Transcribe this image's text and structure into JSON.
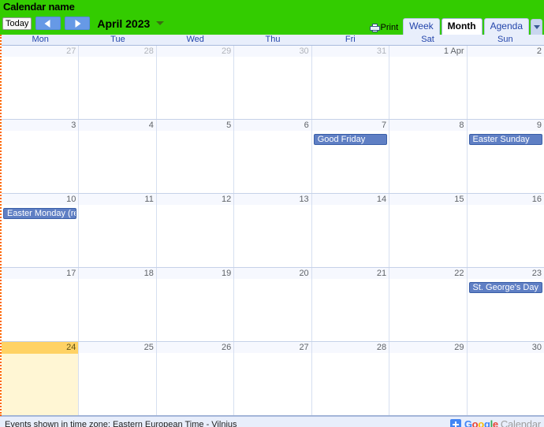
{
  "header": {
    "calendar_name": "Calendar name",
    "today_button": "Today",
    "prev_label": "Previous",
    "next_label": "Next",
    "period": "April 2023",
    "print_label": "Print",
    "views": [
      {
        "label": "Week",
        "active": false
      },
      {
        "label": "Month",
        "active": true
      },
      {
        "label": "Agenda",
        "active": false
      }
    ],
    "background_color": "#33cc00",
    "title_color": "#000000"
  },
  "weekdays": [
    "Mon",
    "Tue",
    "Wed",
    "Thu",
    "Fri",
    "Sat",
    "Sun"
  ],
  "weeks": [
    {
      "days": [
        {
          "num": "27",
          "othermonth": true,
          "today": false,
          "events": []
        },
        {
          "num": "28",
          "othermonth": true,
          "today": false,
          "events": []
        },
        {
          "num": "29",
          "othermonth": true,
          "today": false,
          "events": []
        },
        {
          "num": "30",
          "othermonth": true,
          "today": false,
          "events": []
        },
        {
          "num": "31",
          "othermonth": true,
          "today": false,
          "events": []
        },
        {
          "num": "1 Apr",
          "othermonth": false,
          "today": false,
          "events": []
        },
        {
          "num": "2",
          "othermonth": false,
          "today": false,
          "events": []
        }
      ]
    },
    {
      "days": [
        {
          "num": "3",
          "othermonth": false,
          "today": false,
          "events": []
        },
        {
          "num": "4",
          "othermonth": false,
          "today": false,
          "events": []
        },
        {
          "num": "5",
          "othermonth": false,
          "today": false,
          "events": []
        },
        {
          "num": "6",
          "othermonth": false,
          "today": false,
          "events": []
        },
        {
          "num": "7",
          "othermonth": false,
          "today": false,
          "events": [
            "Good Friday"
          ]
        },
        {
          "num": "8",
          "othermonth": false,
          "today": false,
          "events": []
        },
        {
          "num": "9",
          "othermonth": false,
          "today": false,
          "events": [
            "Easter Sunday"
          ]
        }
      ]
    },
    {
      "days": [
        {
          "num": "10",
          "othermonth": false,
          "today": false,
          "events": [
            "Easter Monday (re"
          ]
        },
        {
          "num": "11",
          "othermonth": false,
          "today": false,
          "events": []
        },
        {
          "num": "12",
          "othermonth": false,
          "today": false,
          "events": []
        },
        {
          "num": "13",
          "othermonth": false,
          "today": false,
          "events": []
        },
        {
          "num": "14",
          "othermonth": false,
          "today": false,
          "events": []
        },
        {
          "num": "15",
          "othermonth": false,
          "today": false,
          "events": []
        },
        {
          "num": "16",
          "othermonth": false,
          "today": false,
          "events": []
        }
      ]
    },
    {
      "days": [
        {
          "num": "17",
          "othermonth": false,
          "today": false,
          "events": []
        },
        {
          "num": "18",
          "othermonth": false,
          "today": false,
          "events": []
        },
        {
          "num": "19",
          "othermonth": false,
          "today": false,
          "events": []
        },
        {
          "num": "20",
          "othermonth": false,
          "today": false,
          "events": []
        },
        {
          "num": "21",
          "othermonth": false,
          "today": false,
          "events": []
        },
        {
          "num": "22",
          "othermonth": false,
          "today": false,
          "events": []
        },
        {
          "num": "23",
          "othermonth": false,
          "today": false,
          "events": [
            "St. George's Day"
          ]
        }
      ]
    },
    {
      "days": [
        {
          "num": "24",
          "othermonth": false,
          "today": true,
          "events": []
        },
        {
          "num": "25",
          "othermonth": false,
          "today": false,
          "events": []
        },
        {
          "num": "26",
          "othermonth": false,
          "today": false,
          "events": []
        },
        {
          "num": "27",
          "othermonth": false,
          "today": false,
          "events": []
        },
        {
          "num": "28",
          "othermonth": false,
          "today": false,
          "events": []
        },
        {
          "num": "29",
          "othermonth": false,
          "today": false,
          "events": []
        },
        {
          "num": "30",
          "othermonth": false,
          "today": false,
          "events": []
        }
      ]
    }
  ],
  "footer": {
    "timezone_note": "Events shown in time zone: Eastern European Time - Vilnius",
    "brand_google": "Google",
    "brand_product": "Calendar",
    "brand_letters": [
      "G",
      "o",
      "o",
      "g",
      "l",
      "e"
    ]
  },
  "colors": {
    "event_fill": "#5f7fc4",
    "event_border": "#3a5fa8",
    "today_band": "#ffd264",
    "today_body": "#fff6d4",
    "weekday_header_bg": "#e8eefb",
    "weekday_text": "#2244aa",
    "frame_dotted": "#ff6600"
  }
}
